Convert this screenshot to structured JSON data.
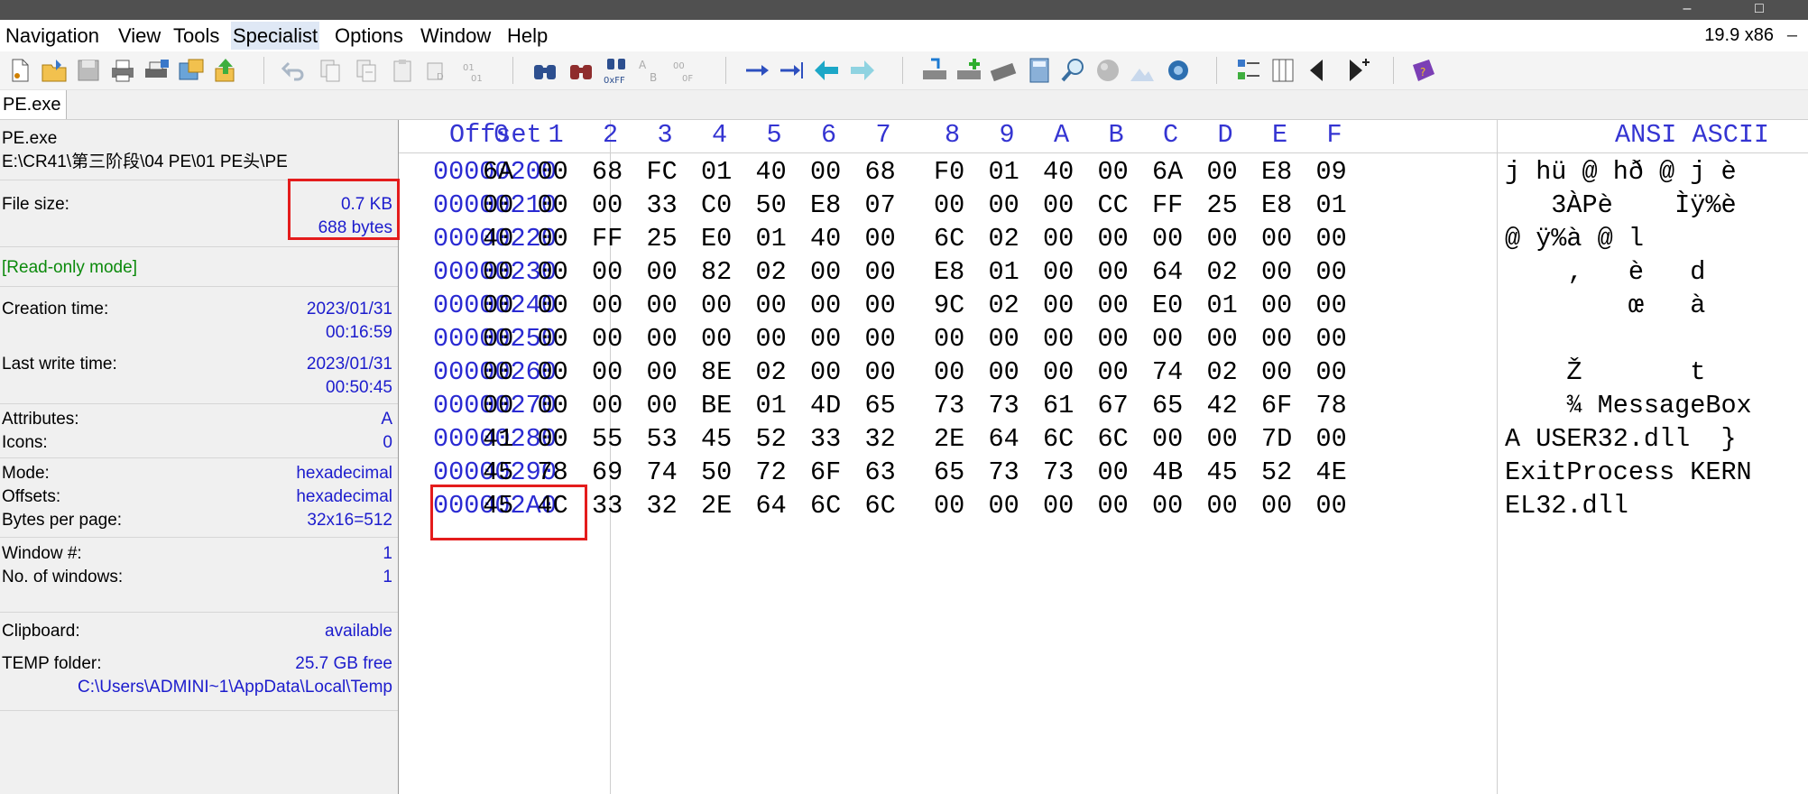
{
  "window": {
    "version": "19.9 x86",
    "controls": [
      "–",
      "□"
    ]
  },
  "menu": [
    "Navigation",
    "View",
    "Tools",
    "Specialist",
    "Options",
    "Window",
    "Help"
  ],
  "toolbar_icons": [
    "new-file-icon",
    "open-file-icon",
    "save-icon",
    "print-icon",
    "print-preview-icon",
    "properties-icon",
    "export-icon",
    "undo-icon",
    "copy-icon",
    "cut-icon",
    "paste-icon",
    "paste-write-icon",
    "clipboard-data-icon",
    "find-icon",
    "find-replace-icon",
    "find-hex-icon",
    "replace-hex-icon",
    "replace-text-icon",
    "goto-offset-icon",
    "goto-sector-icon",
    "back-icon",
    "forward-icon",
    "open-disk-icon",
    "add-disk-icon",
    "ram-editor-icon",
    "calculator-icon",
    "search-icon",
    "hash-icon",
    "analyze-icon",
    "settings-icon",
    "data-interpreter-icon",
    "columns-icon",
    "previous-block-icon",
    "next-block-icon",
    "help-icon"
  ],
  "tab": {
    "label": "PE.exe"
  },
  "info": {
    "file_name": "PE.exe",
    "file_path": "E:\\CR41\\第三阶段\\04 PE\\01 PE头\\PE",
    "file_size_label": "File size:",
    "file_size_kb": "0.7 KB",
    "file_size_bytes": "688 bytes",
    "mode_note": "[Read-only mode]",
    "creation_label": "Creation time:",
    "creation_date": "2023/01/31",
    "creation_time": "00:16:59",
    "lastwrite_label": "Last write time:",
    "lastwrite_date": "2023/01/31",
    "lastwrite_time": "00:50:45",
    "attributes_label": "Attributes:",
    "attributes_value": "A",
    "icons_label": "Icons:",
    "icons_value": "0",
    "mode_label": "Mode:",
    "mode_value": "hexadecimal",
    "offsets_label": "Offsets:",
    "offsets_value": "hexadecimal",
    "bpp_label": "Bytes per page:",
    "bpp_value": "32x16=512",
    "window_no_label": "Window #:",
    "window_no_value": "1",
    "windows_count_label": "No. of windows:",
    "windows_count_value": "1",
    "clipboard_label": "Clipboard:",
    "clipboard_value": "available",
    "temp_label": "TEMP folder:",
    "temp_free": "25.7 GB free",
    "temp_path": "C:\\Users\\ADMINI~1\\AppData\\Local\\Temp"
  },
  "hex": {
    "offset_header": "Offset",
    "column_headers": [
      "0",
      "1",
      "2",
      "3",
      "4",
      "5",
      "6",
      "7",
      "8",
      "9",
      "A",
      "B",
      "C",
      "D",
      "E",
      "F"
    ],
    "text_header": "ANSI ASCII",
    "rows": [
      {
        "offset": "00000200",
        "bytes": [
          "6A",
          "00",
          "68",
          "FC",
          "01",
          "40",
          "00",
          "68",
          "F0",
          "01",
          "40",
          "00",
          "6A",
          "00",
          "E8",
          "09"
        ],
        "text": "j hü @ hð @ j è"
      },
      {
        "offset": "00000210",
        "bytes": [
          "00",
          "00",
          "00",
          "33",
          "C0",
          "50",
          "E8",
          "07",
          "00",
          "00",
          "00",
          "CC",
          "FF",
          "25",
          "E8",
          "01"
        ],
        "text": "   3ÀPè    Ìÿ%è"
      },
      {
        "offset": "00000220",
        "bytes": [
          "40",
          "00",
          "FF",
          "25",
          "E0",
          "01",
          "40",
          "00",
          "6C",
          "02",
          "00",
          "00",
          "00",
          "00",
          "00",
          "00"
        ],
        "text": "@ ÿ%à @ l"
      },
      {
        "offset": "00000230",
        "bytes": [
          "00",
          "00",
          "00",
          "00",
          "82",
          "02",
          "00",
          "00",
          "E8",
          "01",
          "00",
          "00",
          "64",
          "02",
          "00",
          "00"
        ],
        "text": "    ‚   è   d"
      },
      {
        "offset": "00000240",
        "bytes": [
          "00",
          "00",
          "00",
          "00",
          "00",
          "00",
          "00",
          "00",
          "9C",
          "02",
          "00",
          "00",
          "E0",
          "01",
          "00",
          "00"
        ],
        "text": "        œ   à"
      },
      {
        "offset": "00000250",
        "bytes": [
          "00",
          "00",
          "00",
          "00",
          "00",
          "00",
          "00",
          "00",
          "00",
          "00",
          "00",
          "00",
          "00",
          "00",
          "00",
          "00"
        ],
        "text": ""
      },
      {
        "offset": "00000260",
        "bytes": [
          "00",
          "00",
          "00",
          "00",
          "8E",
          "02",
          "00",
          "00",
          "00",
          "00",
          "00",
          "00",
          "74",
          "02",
          "00",
          "00"
        ],
        "text": "    Ž       t"
      },
      {
        "offset": "00000270",
        "bytes": [
          "00",
          "00",
          "00",
          "00",
          "BE",
          "01",
          "4D",
          "65",
          "73",
          "73",
          "61",
          "67",
          "65",
          "42",
          "6F",
          "78"
        ],
        "text": "    ¾ MessageBox"
      },
      {
        "offset": "00000280",
        "bytes": [
          "41",
          "00",
          "55",
          "53",
          "45",
          "52",
          "33",
          "32",
          "2E",
          "64",
          "6C",
          "6C",
          "00",
          "00",
          "7D",
          "00"
        ],
        "text": "A USER32.dll  }"
      },
      {
        "offset": "00000290",
        "bytes": [
          "45",
          "78",
          "69",
          "74",
          "50",
          "72",
          "6F",
          "63",
          "65",
          "73",
          "73",
          "00",
          "4B",
          "45",
          "52",
          "4E"
        ],
        "text": "ExitProcess KERN"
      },
      {
        "offset": "000002A0",
        "bytes": [
          "45",
          "4C",
          "33",
          "32",
          "2E",
          "64",
          "6C",
          "6C",
          "00",
          "00",
          "00",
          "00",
          "00",
          "00",
          "00",
          "00"
        ],
        "text": "EL32.dll"
      }
    ]
  }
}
